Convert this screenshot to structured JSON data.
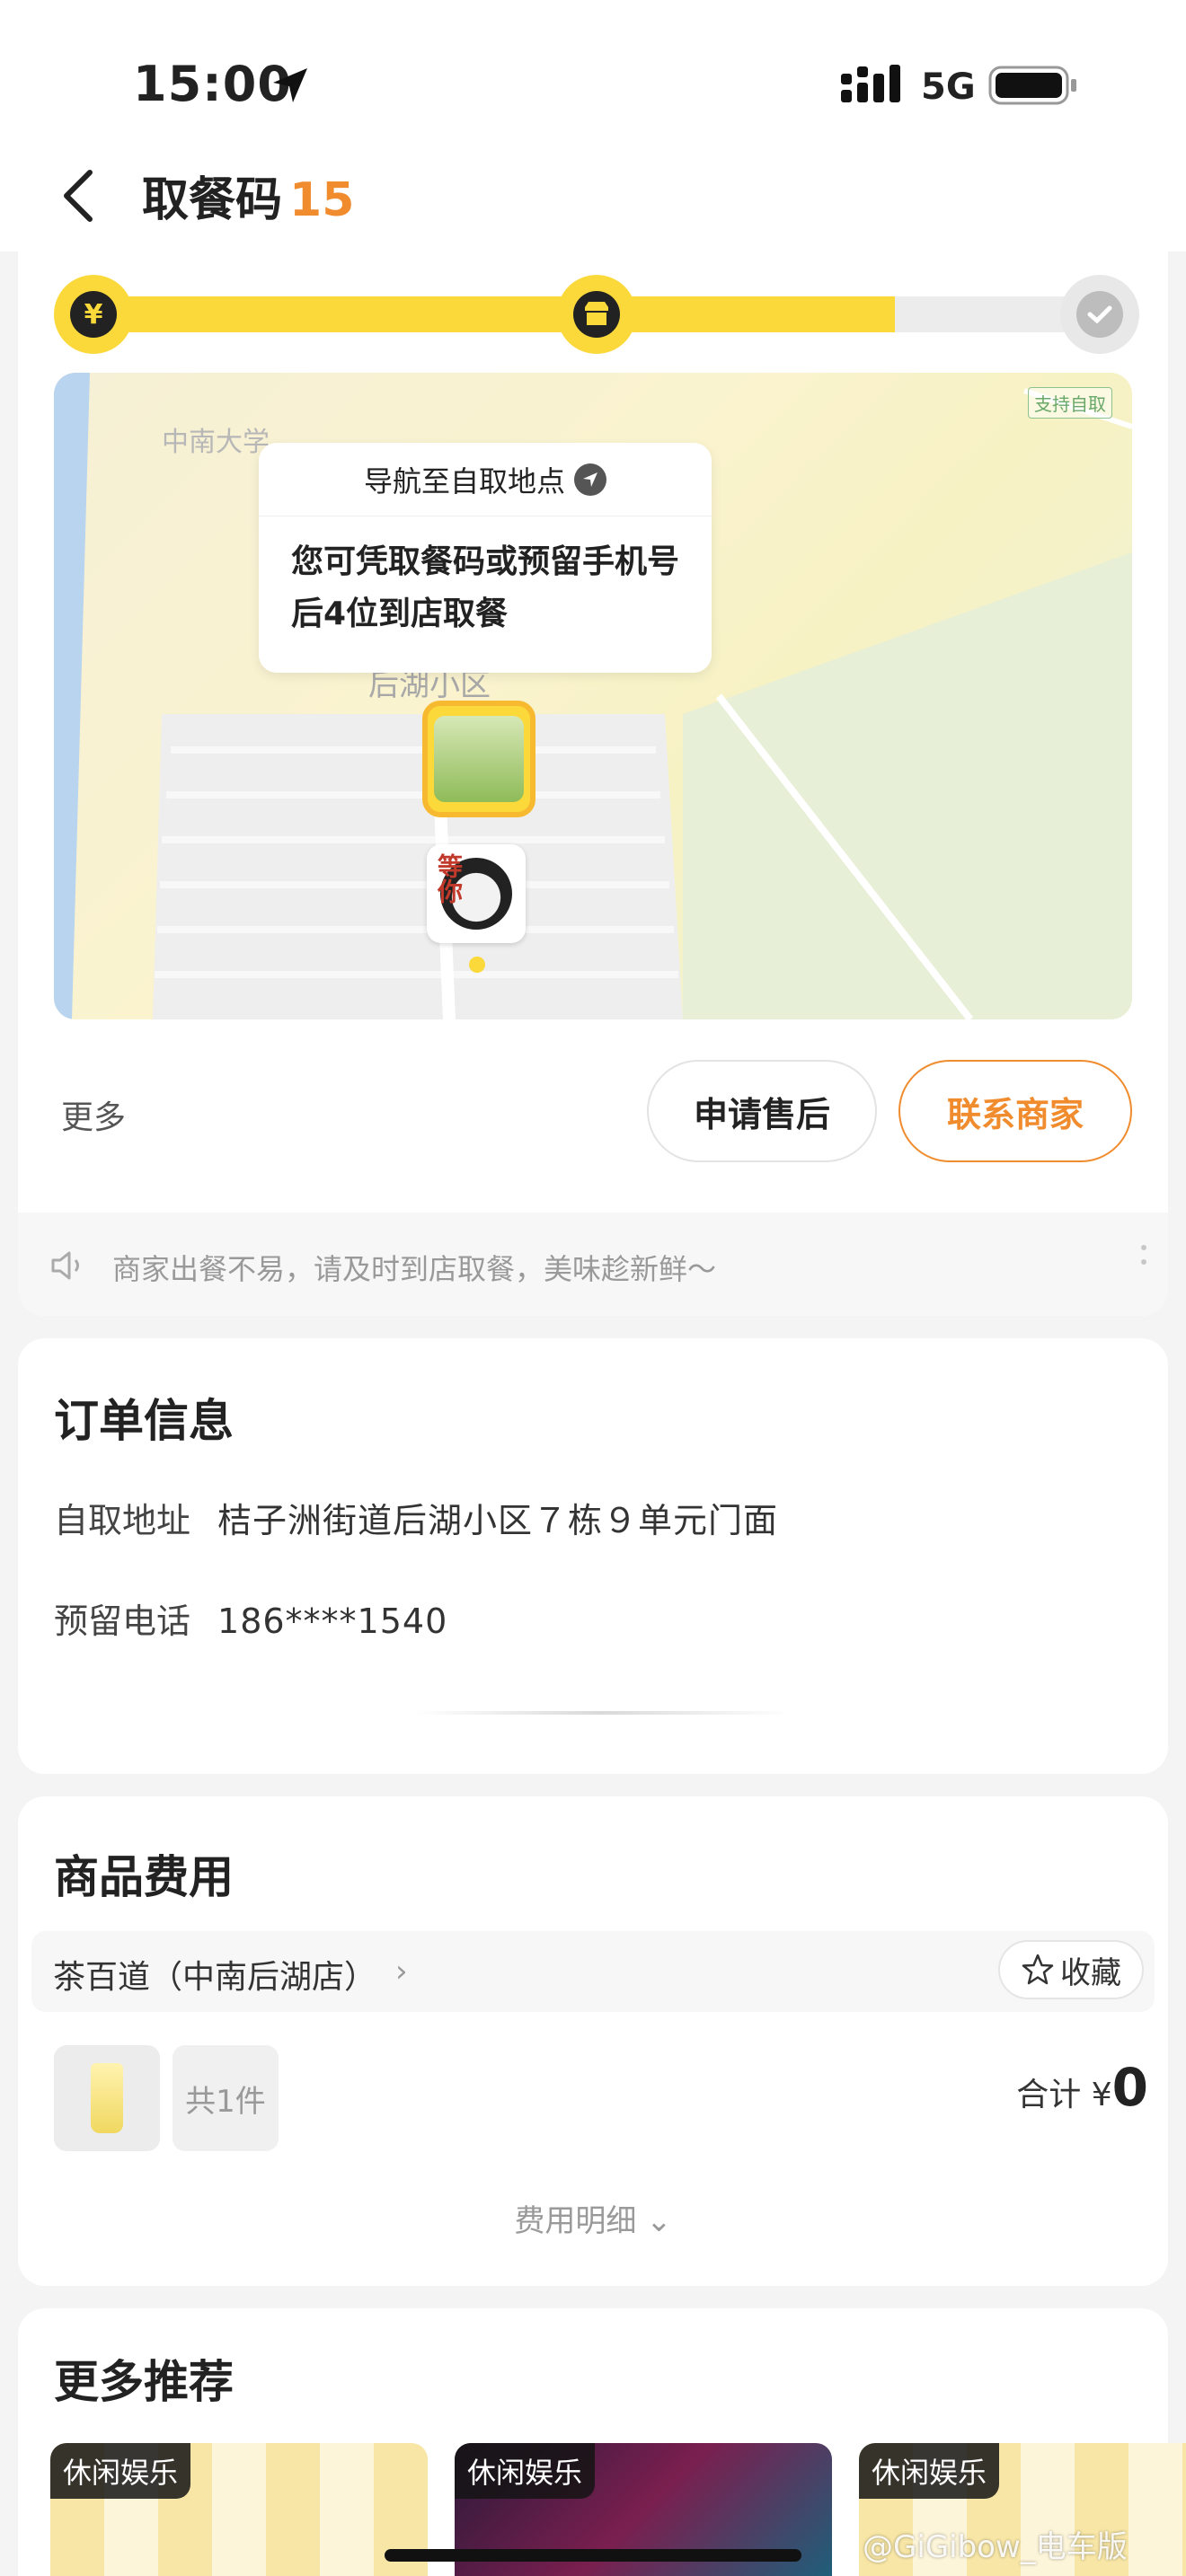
{
  "status_bar": {
    "time": "15:00",
    "network": "5G"
  },
  "nav": {
    "title": "取餐码",
    "code": "15"
  },
  "progress": {
    "fraction": 0.8,
    "step_icons": [
      "yuan-icon",
      "store-icon",
      "check-icon"
    ]
  },
  "map": {
    "label_area": "中南大学",
    "label_community": "后湖小区",
    "badge": "支持自取",
    "popup_nav": "导航至自取地点",
    "popup_text": "您可凭取餐码或预留手机号后4位到店取餐",
    "user_tag": "等你"
  },
  "actions": {
    "more": "更多",
    "after_sale": "申请售后",
    "contact": "联系商家"
  },
  "notice": "商家出餐不易，请及时到店取餐，美味趁新鲜～",
  "order": {
    "title": "订单信息",
    "address_label": "自取地址",
    "address_value": "桔子洲街道后湖小区７栋９单元门面",
    "phone_label": "预留电话",
    "phone_value": "186****1540"
  },
  "fee": {
    "title": "商品费用",
    "shop": "茶百道（中南后湖店）",
    "fav": "收藏",
    "count": "共1件",
    "total_label": "合计",
    "currency": "¥",
    "total": "0",
    "detail": "费用明细"
  },
  "recommend": {
    "title": "更多推荐",
    "tags": [
      "休闲娱乐",
      "休闲娱乐",
      "休闲娱乐"
    ]
  },
  "watermark": "@GiGibow_电车版",
  "colors": {
    "accent_yellow": "#fbd93a",
    "accent_orange": "#f08c2e"
  }
}
